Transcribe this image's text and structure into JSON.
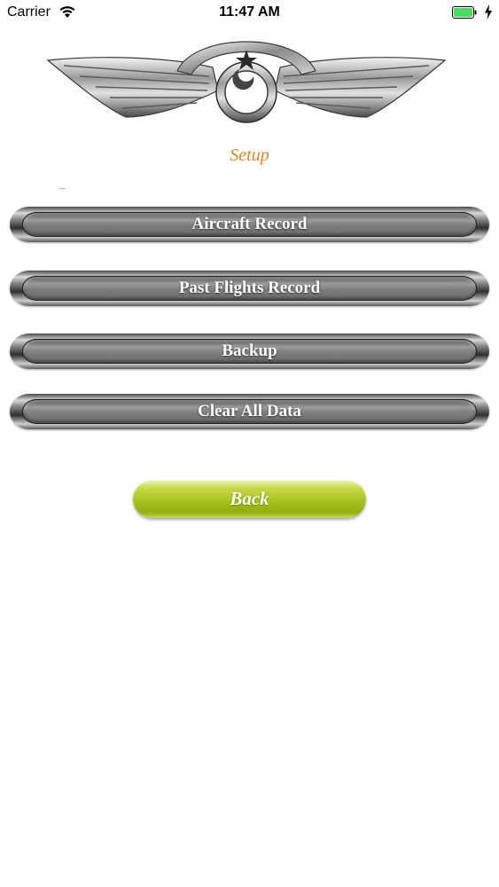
{
  "status_bar": {
    "carrier": "Carrier",
    "time": "11:47 AM",
    "wifi_icon": "wifi-icon",
    "battery_icon": "battery-full-icon",
    "charging_icon": "charging-bolt-icon",
    "battery_color": "#4cd964"
  },
  "header": {
    "logo_icon": "pilot-wings-emblem-icon",
    "title": "Setup",
    "title_color": "#e0822a"
  },
  "menu": {
    "items": [
      {
        "label": "Aircraft Record"
      },
      {
        "label": "Past Flights Record"
      },
      {
        "label": "Backup"
      },
      {
        "label": "Clear All Data"
      }
    ]
  },
  "footer": {
    "back_label": "Back",
    "back_color": "#a9c21e"
  }
}
